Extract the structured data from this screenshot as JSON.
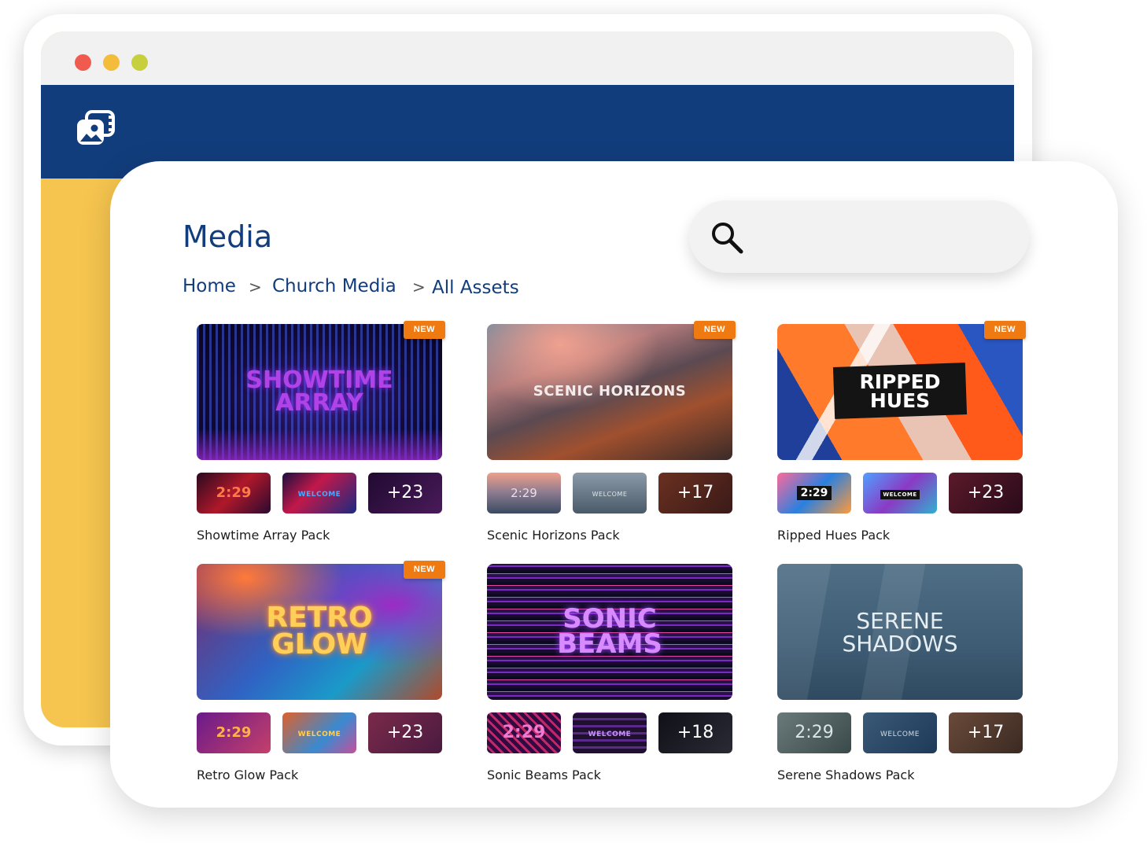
{
  "page": {
    "title": "Media",
    "search_placeholder": ""
  },
  "breadcrumb": [
    {
      "label": "Home"
    },
    {
      "label": "Church Media"
    },
    {
      "label": "All Assets"
    }
  ],
  "colors": {
    "navbar": "#123d7c",
    "accent_yellow": "#f6c54f",
    "badge": "#f07a12",
    "title_text": "#123d7c"
  },
  "icons": {
    "app_logo": "media-library-icon",
    "search": "search-icon"
  },
  "cards": [
    {
      "name": "Showtime Array Pack",
      "hero_text": [
        "SHOWTIME",
        "ARRAY"
      ],
      "badge": "NEW",
      "thumb_time": "2:29",
      "thumb_welcome": "WELCOME",
      "more_count": "+23"
    },
    {
      "name": "Scenic Horizons Pack",
      "hero_text": [
        "SCENIC HORIZONS"
      ],
      "badge": "NEW",
      "thumb_time": "2:29",
      "thumb_welcome": "WELCOME",
      "more_count": "+17"
    },
    {
      "name": "Ripped Hues Pack",
      "hero_text": [
        "RIPPED",
        "HUES"
      ],
      "badge": "NEW",
      "thumb_time": "2:29",
      "thumb_welcome": "WELCOME",
      "more_count": "+23"
    },
    {
      "name": "Retro Glow Pack",
      "hero_text": [
        "RETRO",
        "GLOW"
      ],
      "badge": "NEW",
      "thumb_time": "2:29",
      "thumb_welcome": "WELCOME",
      "more_count": "+23"
    },
    {
      "name": "Sonic Beams Pack",
      "hero_text": [
        "SONIC",
        "BEAMS"
      ],
      "badge": "",
      "thumb_time": "2:29",
      "thumb_welcome": "WELCOME",
      "more_count": "+18"
    },
    {
      "name": "Serene Shadows Pack",
      "hero_text": [
        "SERENE",
        "SHADOWS"
      ],
      "badge": "",
      "thumb_time": "2:29",
      "thumb_welcome": "WELCOME",
      "more_count": "+17"
    }
  ]
}
